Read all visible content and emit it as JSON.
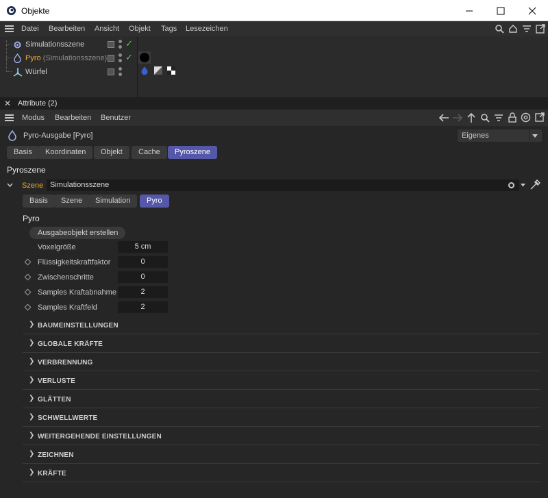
{
  "window": {
    "title": "Objekte",
    "minimize": "—",
    "maximize": "☐",
    "close": "✕"
  },
  "menu": [
    "Datei",
    "Bearbeiten",
    "Ansicht",
    "Objekt",
    "Tags",
    "Lesezeichen"
  ],
  "objects": [
    {
      "name": "Simulationsszene",
      "sub": "",
      "color": "#cfcfcf"
    },
    {
      "name": "Pyro",
      "sub": "(Simulationsszene)",
      "color": "#f0a830"
    },
    {
      "name": "Würfel",
      "sub": "",
      "color": "#cfcfcf"
    }
  ],
  "attributes": {
    "header": "Attribute (2)",
    "menu": [
      "Modus",
      "Bearbeiten",
      "Benutzer"
    ],
    "object_title": "Pyro-Ausgabe [Pyro]",
    "mode_dropdown": "Eigenes",
    "tabs": [
      "Basis",
      "Koordinaten",
      "Objekt",
      "Cache",
      "Pyroszene"
    ],
    "active_tab": "Pyroszene",
    "section_title": "Pyroszene",
    "scene_label": "Szene",
    "scene_value": "Simulationsszene",
    "sub_tabs": [
      "Basis",
      "Szene",
      "Simulation",
      "Pyro"
    ],
    "sub_active": "Pyro",
    "group_title": "Pyro",
    "create_button": "Ausgabeobjekt erstellen",
    "params": [
      {
        "label": "Voxelgröße",
        "value": "5 cm",
        "diamond": false
      },
      {
        "label": "Flüssigkeitskraftfaktor",
        "value": "0",
        "diamond": true
      },
      {
        "label": "Zwischenschritte",
        "value": "0",
        "diamond": true
      },
      {
        "label": "Samples Kraftabnahme",
        "value": "2",
        "diamond": true
      },
      {
        "label": "Samples Kraftfeld",
        "value": "2",
        "diamond": true
      }
    ],
    "sections": [
      "BAUMEINSTELLUNGEN",
      "GLOBALE KRÄFTE",
      "VERBRENNUNG",
      "VERLUSTE",
      "GLÄTTEN",
      "SCHWELLWERTE",
      "WEITERGEHENDE EINSTELLUNGEN",
      "ZEICHNEN",
      "KRÄFTE"
    ]
  },
  "colors": {
    "accent": "#5558a8",
    "pyro": "#f0a830",
    "check": "#4fd05a"
  }
}
